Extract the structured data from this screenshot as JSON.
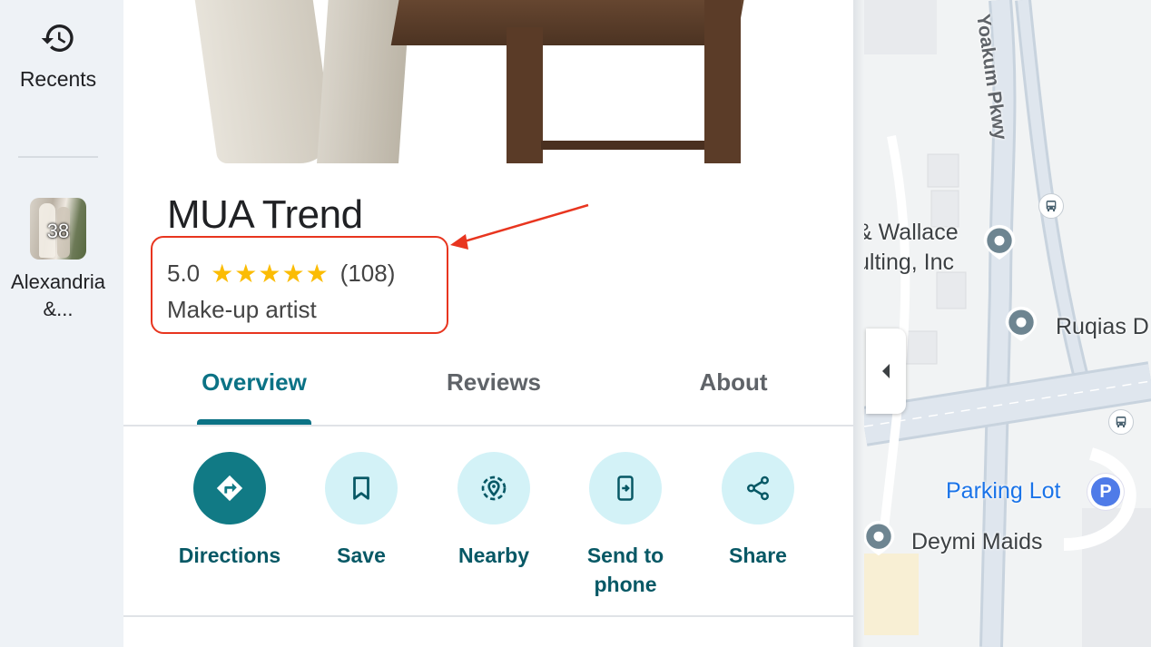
{
  "rail": {
    "recents_label": "Recents",
    "recent_item": {
      "count": "38",
      "label": "Alexandria &..."
    }
  },
  "place": {
    "name": "MUA Trend",
    "rating": "5.0",
    "stars": "★★★★★",
    "review_count": "(108)",
    "category": "Make-up artist"
  },
  "tabs": [
    {
      "label": "Overview",
      "active": true
    },
    {
      "label": "Reviews",
      "active": false
    },
    {
      "label": "About",
      "active": false
    }
  ],
  "actions": [
    {
      "label": "Directions",
      "icon": "directions-icon",
      "primary": true
    },
    {
      "label": "Save",
      "icon": "bookmark-icon"
    },
    {
      "label": "Nearby",
      "icon": "nearby-icon"
    },
    {
      "label": "Send to phone",
      "icon": "send-to-phone-icon"
    },
    {
      "label": "Share",
      "icon": "share-icon"
    }
  ],
  "map": {
    "road_label": "Yoakum Pkwy",
    "places": [
      {
        "label": "& Wallace\nulting, Inc"
      },
      {
        "label": "Ruqias D"
      },
      {
        "label": "Parking Lot"
      },
      {
        "label": "Deymi Maids"
      }
    ],
    "parking_letter": "P"
  },
  "colors": {
    "accent": "#0b7285",
    "action_bg": "#d3f2f7",
    "star": "#fbbc04",
    "annotation": "#e8351f"
  }
}
